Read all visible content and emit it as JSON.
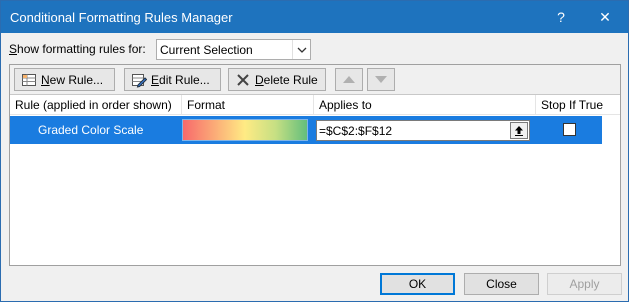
{
  "window": {
    "title": "Conditional Formatting Rules Manager",
    "help_glyph": "?",
    "close_glyph": "✕"
  },
  "show_rules": {
    "label_prefix": "S",
    "label_rest": "how formatting rules for:",
    "selected": "Current Selection"
  },
  "toolbar": {
    "new_rule": {
      "underline": "N",
      "rest": "ew Rule..."
    },
    "edit_rule": {
      "underline": "E",
      "rest": "dit Rule..."
    },
    "delete_rule": {
      "underline": "D",
      "rest": "elete Rule"
    }
  },
  "table": {
    "headers": [
      "Rule (applied in order shown)",
      "Format",
      "Applies to",
      "Stop If True"
    ],
    "rows": [
      {
        "rule": "Graded Color Scale",
        "applies_to": "=$C$2:$F$12",
        "stop_if_true": false
      }
    ]
  },
  "footer": {
    "ok": "OK",
    "close": "Close",
    "apply": "Apply"
  },
  "colors": {
    "titlebar": "#1e73be",
    "selection": "#1a7ce0",
    "scale_low": "#f8696b",
    "scale_mid": "#ffeb84",
    "scale_high": "#63be7b"
  }
}
